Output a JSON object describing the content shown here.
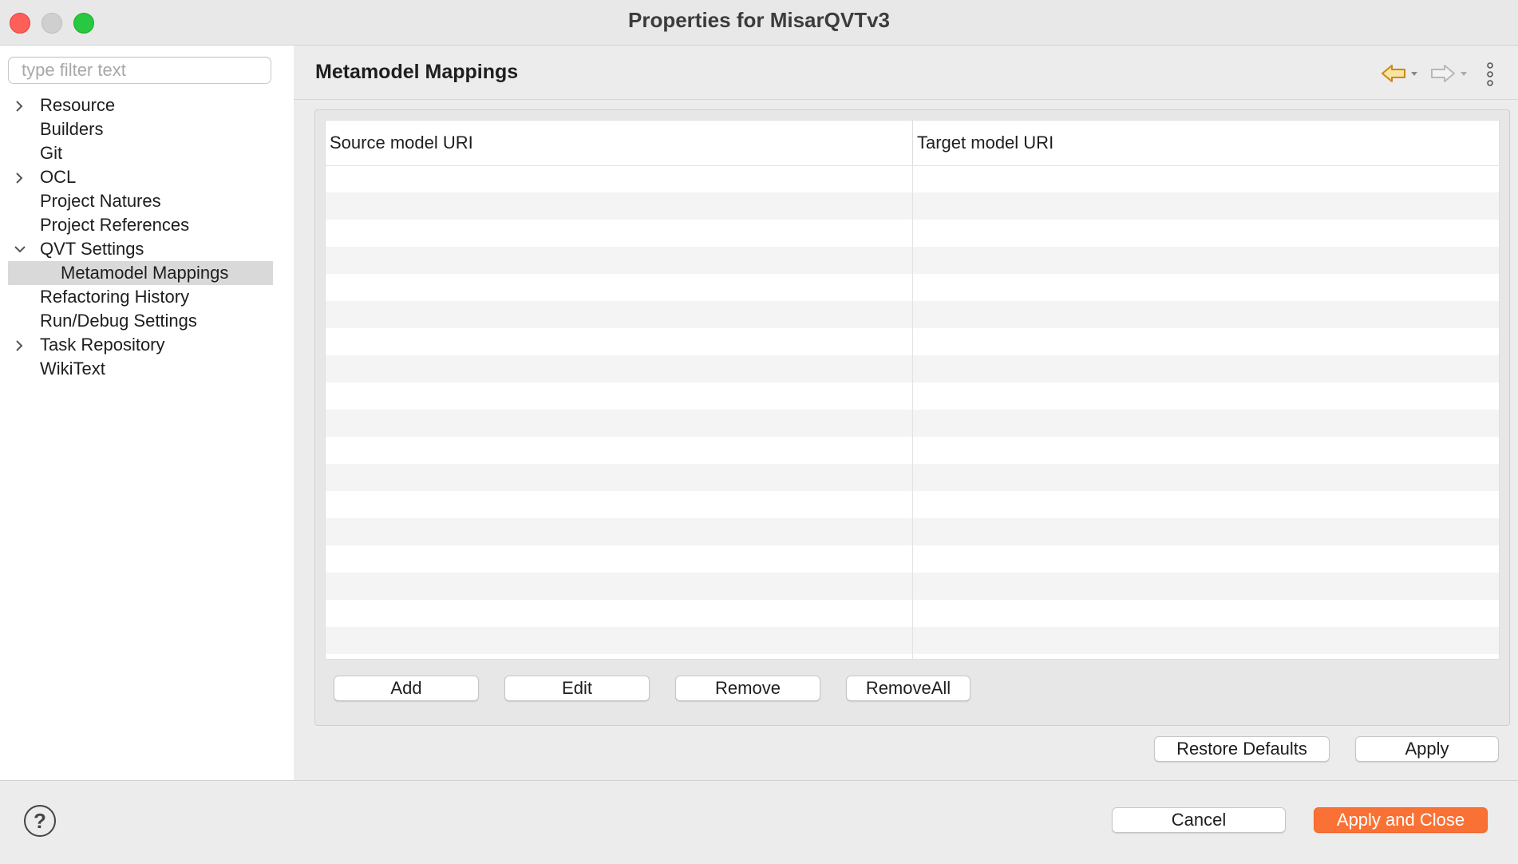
{
  "window": {
    "title": "Properties for MisarQVTv3"
  },
  "filter": {
    "placeholder": "type filter text"
  },
  "tree": [
    {
      "label": "Resource",
      "chevron": "collapsed",
      "level": 0
    },
    {
      "label": "Builders",
      "chevron": "none",
      "level": 0
    },
    {
      "label": "Git",
      "chevron": "none",
      "level": 0
    },
    {
      "label": "OCL",
      "chevron": "collapsed",
      "level": 0
    },
    {
      "label": "Project Natures",
      "chevron": "none",
      "level": 0
    },
    {
      "label": "Project References",
      "chevron": "none",
      "level": 0
    },
    {
      "label": "QVT Settings",
      "chevron": "expanded",
      "level": 0
    },
    {
      "label": "Metamodel Mappings",
      "chevron": "none",
      "level": 1,
      "selected": true
    },
    {
      "label": "Refactoring History",
      "chevron": "none",
      "level": 0
    },
    {
      "label": "Run/Debug Settings",
      "chevron": "none",
      "level": 0
    },
    {
      "label": "Task Repository",
      "chevron": "collapsed",
      "level": 0
    },
    {
      "label": "WikiText",
      "chevron": "none",
      "level": 0
    }
  ],
  "page": {
    "title": "Metamodel Mappings",
    "nav_icons": [
      "back-arrow-icon",
      "forward-arrow-icon",
      "more-vertical-icon"
    ],
    "table": {
      "columns": [
        "Source model URI",
        "Target model URI"
      ],
      "rows": []
    },
    "buttons": {
      "add": "Add",
      "edit": "Edit",
      "remove": "Remove",
      "remove_all": "RemoveAll"
    },
    "restore_defaults": "Restore Defaults",
    "apply": "Apply"
  },
  "footer": {
    "help_icon": "help-icon",
    "cancel": "Cancel",
    "apply_and_close": "Apply and Close",
    "accent_color": "#fa7135"
  }
}
